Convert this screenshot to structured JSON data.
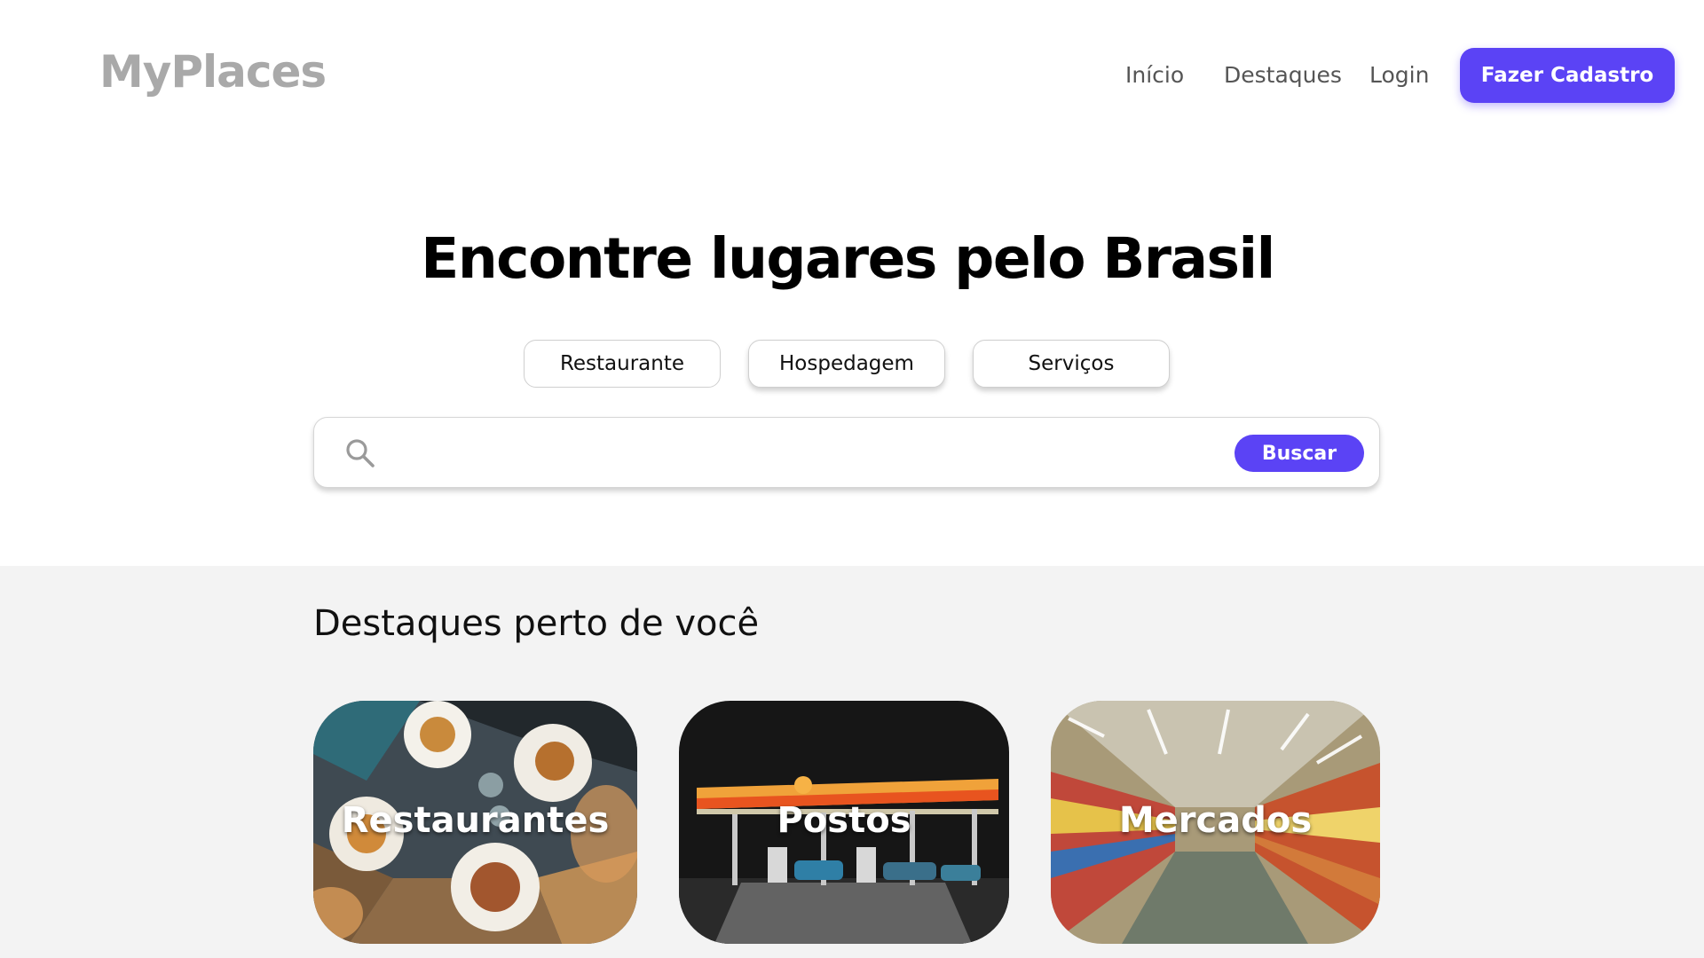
{
  "header": {
    "logo": "MyPlaces",
    "nav": {
      "inicio": "Início",
      "destaques": "Destaques",
      "login": "Login"
    },
    "cta": "Fazer Cadastro"
  },
  "hero": {
    "title": "Encontre lugares pelo Brasil",
    "categories": [
      "Restaurante",
      "Hospedagem",
      "Serviços"
    ],
    "search": {
      "value": "",
      "placeholder": "",
      "button": "Buscar",
      "icon": "search-icon"
    }
  },
  "highlights": {
    "title": "Destaques perto de você",
    "cards": [
      {
        "label": "Restaurantes",
        "image": "restaurant-food-photo"
      },
      {
        "label": "Postos",
        "image": "gas-station-night-photo"
      },
      {
        "label": "Mercados",
        "image": "supermarket-aisle-photo"
      }
    ]
  },
  "colors": {
    "accent": "#5b43f5",
    "logo": "#a9a9a9",
    "section_bg": "#f3f3f3"
  }
}
